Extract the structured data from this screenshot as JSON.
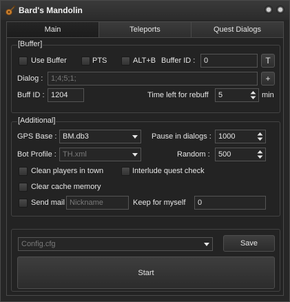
{
  "window": {
    "title": "Bard's Mandolin",
    "icon": "mandolin-icon"
  },
  "tabs": [
    {
      "label": "Main",
      "active": true
    },
    {
      "label": "Teleports",
      "active": false
    },
    {
      "label": "Quest Dialogs",
      "active": false
    }
  ],
  "buffer": {
    "group_label": "[Buffer]",
    "use_buffer_label": "Use Buffer",
    "use_buffer_checked": false,
    "pts_label": "PTS",
    "pts_checked": false,
    "altb_label": "ALT+B",
    "altb_checked": false,
    "buffer_id_label": "Buffer ID :",
    "buffer_id_value": "0",
    "t_button_label": "T",
    "dialog_label": "Dialog :",
    "dialog_value": "1;4;5;1;",
    "add_button_label": "+",
    "buff_id_label": "Buff ID :",
    "buff_id_value": "1204",
    "time_left_label": "Time left for rebuff",
    "time_left_value": "5",
    "min_label": "min"
  },
  "additional": {
    "group_label": "[Additional]",
    "gps_base_label": "GPS Base :",
    "gps_base_value": "BM.db3",
    "pause_label": "Pause in dialogs :",
    "pause_value": "1000",
    "bot_profile_label": "Bot Profile :",
    "bot_profile_value": "TH.xml",
    "random_label": "Random :",
    "random_value": "500",
    "clean_players_label": "Clean players in town",
    "clean_players_checked": false,
    "interlude_label": "Interlude quest check",
    "interlude_checked": false,
    "clear_cache_label": "Clear cache memory",
    "clear_cache_checked": false,
    "send_mail_label": "Send mail",
    "send_mail_checked": false,
    "nickname_placeholder": "Nickname",
    "keep_label": "Keep for myself",
    "keep_value": "0"
  },
  "bottom": {
    "config_value": "Config.cfg",
    "save_label": "Save",
    "start_label": "Start"
  }
}
